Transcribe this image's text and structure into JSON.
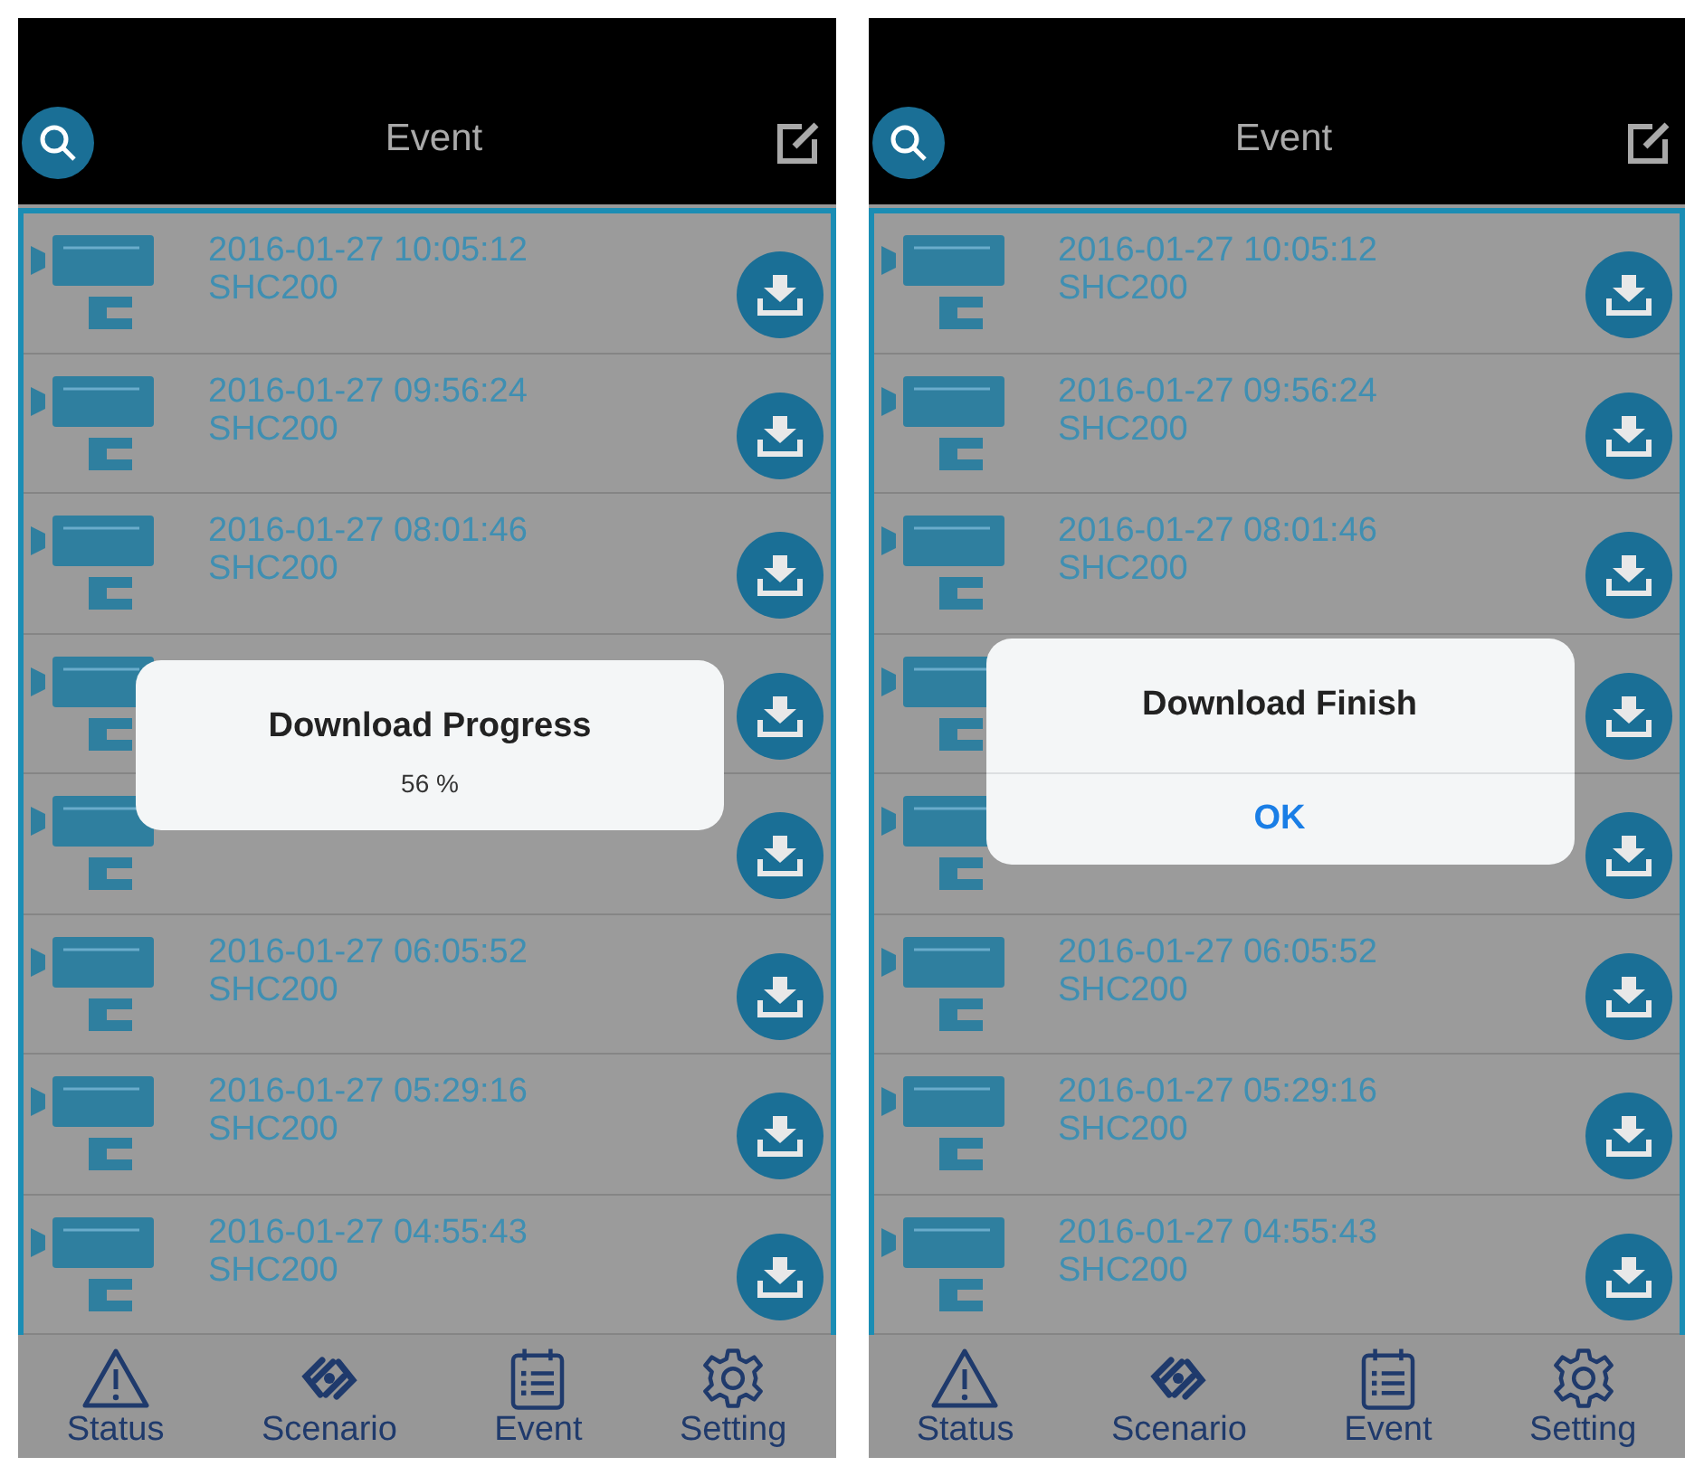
{
  "screens": [
    {
      "header": {
        "title": "Event"
      },
      "events": [
        {
          "kind": "event",
          "time": "2016-01-27 10:05:12",
          "device": "SHC200"
        },
        {
          "kind": "event",
          "time": "2016-01-27 09:56:24",
          "device": "SHC200"
        },
        {
          "kind": "event",
          "time": "2016-01-27 08:01:46",
          "device": "SHC200"
        },
        {
          "kind": "covered"
        },
        {
          "kind": "covered"
        },
        {
          "kind": "event",
          "time": "2016-01-27 06:05:52",
          "device": "SHC200"
        },
        {
          "kind": "event",
          "time": "2016-01-27 05:29:16",
          "device": "SHC200"
        },
        {
          "kind": "event",
          "time": "2016-01-27 04:55:43",
          "device": "SHC200"
        }
      ],
      "dialog": {
        "kind": "progress",
        "title": "Download Progress",
        "message": "56 %"
      },
      "tab_bar": [
        {
          "label": "Status",
          "kind": "status"
        },
        {
          "label": "Scenario",
          "kind": "scenario"
        },
        {
          "label": "Event",
          "kind": "event"
        },
        {
          "label": "Setting",
          "kind": "setting"
        }
      ]
    },
    {
      "header": {
        "title": "Event"
      },
      "events": [
        {
          "kind": "event",
          "time": "2016-01-27 10:05:12",
          "device": "SHC200"
        },
        {
          "kind": "event",
          "time": "2016-01-27 09:56:24",
          "device": "SHC200"
        },
        {
          "kind": "event",
          "time": "2016-01-27 08:01:46",
          "device": "SHC200"
        },
        {
          "kind": "covered"
        },
        {
          "kind": "covered"
        },
        {
          "kind": "event",
          "time": "2016-01-27 06:05:52",
          "device": "SHC200"
        },
        {
          "kind": "event",
          "time": "2016-01-27 05:29:16",
          "device": "SHC200"
        },
        {
          "kind": "event",
          "time": "2016-01-27 04:55:43",
          "device": "SHC200"
        }
      ],
      "dialog": {
        "kind": "alert",
        "title": "Download Finish",
        "buttons": [
          "OK"
        ]
      },
      "tab_bar": [
        {
          "label": "Status",
          "kind": "status"
        },
        {
          "label": "Scenario",
          "kind": "scenario"
        },
        {
          "label": "Event",
          "kind": "event"
        },
        {
          "label": "Setting",
          "kind": "setting"
        }
      ]
    }
  ]
}
